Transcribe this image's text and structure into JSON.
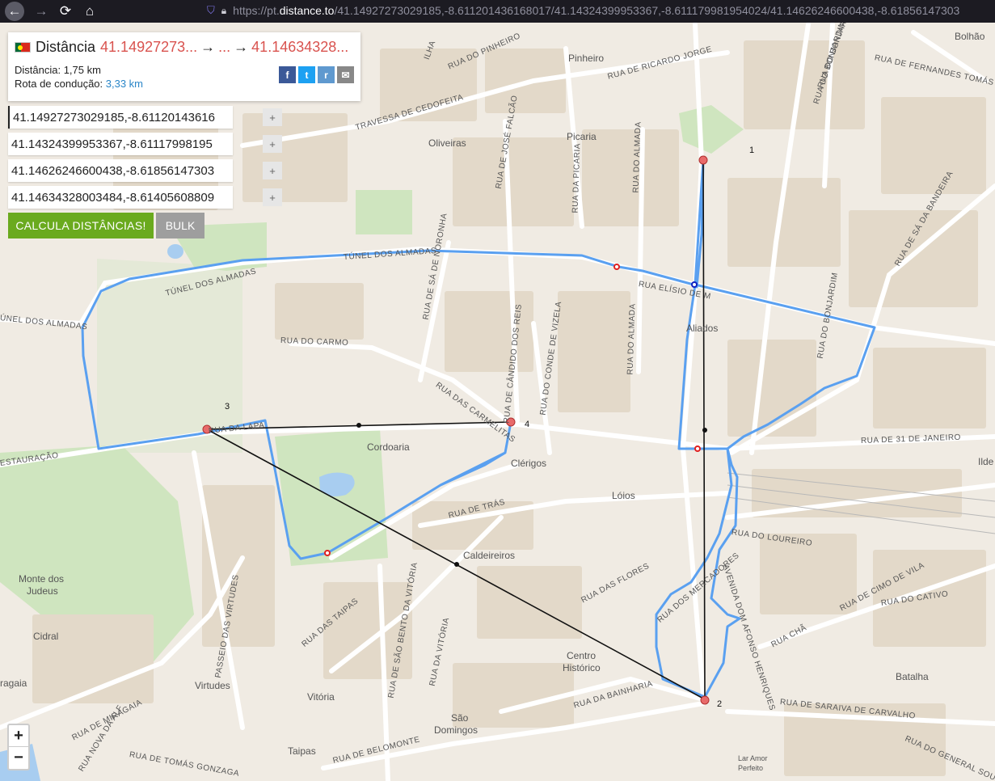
{
  "browser": {
    "url_prefix": "https://pt.",
    "url_host": "distance.to",
    "url_path": "/41.14927273029185,-8.611201436168017/41.14324399953367,-8.611179981954024/41.14626246600438,-8.61856147303"
  },
  "panel": {
    "title": "Distância",
    "from_coord": "41.14927273...",
    "mid_coord": "...",
    "to_coord": "41.14634328...",
    "arrow": "→",
    "distance_label": "Distância:",
    "distance_value": "1,75 km",
    "route_label": "Rota de condução:",
    "route_value": "3,33 km"
  },
  "inputs": [
    "41.14927273029185,-8.61120143616",
    "41.14324399953367,-8.61117998195",
    "41.14626246600438,-8.61856147303",
    "41.14634328003484,-8.61405608809"
  ],
  "buttons": {
    "plus": "+",
    "calc": "CALCULA DISTÂNCIAS!",
    "bulk": "BULK",
    "zoom_in": "+",
    "zoom_out": "−"
  },
  "markers": [
    "1",
    "2",
    "3",
    "4"
  ],
  "places": {
    "bolhao": "Bolhão",
    "pinheiro": "Pinheiro",
    "picaria": "Picaria",
    "oliveiras": "Oliveiras",
    "aliados": "Aliados",
    "cordoaria": "Cordoaria",
    "clerigos": "Clérigos",
    "loios": "Lóios",
    "caldeireiros": "Caldeireiros",
    "monte_judeus_1": "Monte dos",
    "monte_judeus_2": "Judeus",
    "cidral": "Cidral",
    "centro_1": "Centro",
    "centro_2": "Histórico",
    "virtudes": "Virtudes",
    "vitoria": "Vitória",
    "sao_1": "São",
    "sao_2": "Domingos",
    "taipas": "Taipas",
    "batalha": "Batalha",
    "ilde": "Ilde",
    "ragaia": "ragaia",
    "laramor_1": "Lar Amor",
    "laramor_2": "Perfeito"
  },
  "streets": {
    "s1": "RUA DO PINHEIRO",
    "s2": "ILHA",
    "s3": "RUA DE RICARDO JORGE",
    "s4": "TRAVESSA DE CEDOFEITA",
    "s5": "RUA DO BONJARDIM",
    "s6": "RUA DE FERNANDES TOMÁS",
    "s7": "RUA DE SÁ DA BANDEIRA",
    "s8": "TÚNEL DOS ALMADAS",
    "s9": "TÚNEL DOS ALMADAS",
    "s10": "ÚNEL DOS ALMADAS",
    "s11": "RUA ELÍSIO DE M",
    "s12": "RUA DO CARMO",
    "s13": "RUA DAS CARMELITAS",
    "s14": "RUA DA LAPA",
    "s15": "ESTAURAÇÃO",
    "s16": "RUA DE 31 DE JANEIRO",
    "s17": "RUA DE TRÁS",
    "s18": "RUA DO LOUREIRO",
    "s19": "RUA DAS FLORES",
    "s20": "RUA DO CATIVO",
    "s21": "RUA DE CIMO DE VILA",
    "s22": "RUA DOS MERCADORES",
    "s23": "AVENIDA DOM AFONSO HENRIQUES",
    "s24": "RUA CHÃ",
    "s25": "RUA DE SARAIVA DE CARVALHO",
    "s26": "RUA DA BAINHARIA",
    "s27": "RUA DE BELOMONTE",
    "s28": "RUA DE MIRAGAIA",
    "s29": "RUA DE TOMÁS GONZAGA",
    "s30": "RUA NOVA DA ALF",
    "s31": "RUA DAS TAIPAS",
    "s32": "PASSEIO DAS VIRTUDES",
    "s33": "RUA DA VITÓRIA",
    "s34": "RUA DE SÃO BENTO DA VITÓRIA",
    "s35": "RUA DE JOSÉ FALCÃO",
    "s36": "RUA DA PICARIA",
    "s37": "RUA DO ALMADA",
    "s38": "RUA DO ALMADA",
    "s39": "RUA DE SÁ DE NORONHA",
    "s40": "RUA DE CÂNDIDO DOS REIS",
    "s41": "RUA DO CONDE DE VIZELA",
    "s42": "RUA DO GENERAL SOU",
    "s43": "RUA DO BONJARDIM",
    "s44": "RUA DO BONJARDIM"
  },
  "colors": {
    "route": "#5aa0f0",
    "line": "#111111",
    "marker": "#e06060",
    "accent_red": "#d9534f",
    "calc_green": "#6aaa1e"
  },
  "icons": [
    "back-arrow-icon",
    "forward-arrow-icon",
    "reload-icon",
    "home-icon",
    "shield-icon",
    "lock-icon",
    "facebook-icon",
    "twitter-icon",
    "reddit-icon",
    "email-icon"
  ]
}
